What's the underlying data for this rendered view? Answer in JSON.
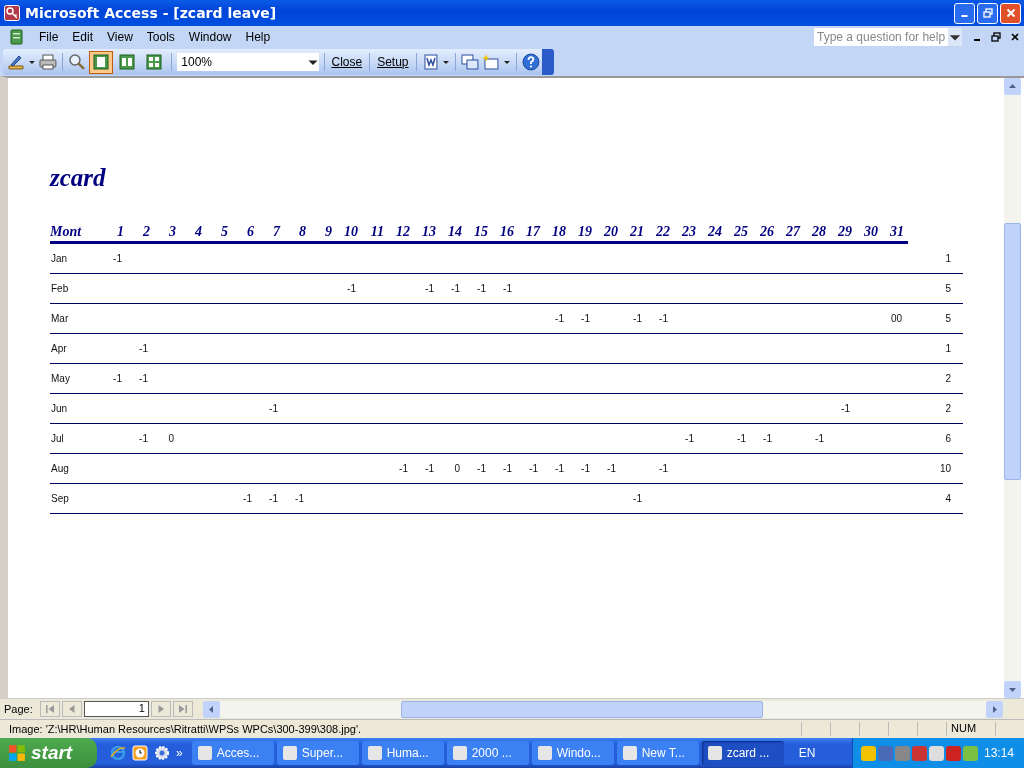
{
  "window": {
    "title": "Microsoft Access - [zcard leave]"
  },
  "menu": {
    "items": [
      "File",
      "Edit",
      "View",
      "Tools",
      "Window",
      "Help"
    ],
    "help_box": {
      "placeholder": "Type a question for help"
    }
  },
  "toolbar": {
    "page_views": [
      {
        "selected": true
      },
      {
        "selected": false
      },
      {
        "selected": false
      }
    ],
    "zoom": "100%",
    "buttons": [
      "Close",
      "Setup"
    ]
  },
  "report": {
    "title": "zcard",
    "columns": [
      "Mont",
      "1",
      "2",
      "3",
      "4",
      "5",
      "6",
      "7",
      "8",
      "9",
      "10",
      "11",
      "12",
      "13",
      "14",
      "15",
      "16",
      "17",
      "18",
      "19",
      "20",
      "21",
      "22",
      "23",
      "24",
      "25",
      "26",
      "27",
      "28",
      "29",
      "30",
      "31"
    ],
    "rows": [
      {
        "month": "Jan",
        "days": [
          {
            "kind": "leave",
            "value": "-1"
          },
          {
            "kind": "blank"
          },
          {
            "kind": "blank"
          },
          {
            "kind": "blank"
          },
          {
            "kind": "blank"
          },
          {
            "kind": "blank"
          },
          {
            "kind": "blank"
          },
          {
            "kind": "blank"
          },
          {
            "kind": "blank"
          },
          {
            "kind": "blank"
          },
          {
            "kind": "blank"
          },
          {
            "kind": "blank"
          },
          {
            "kind": "blank"
          },
          {
            "kind": "blank"
          },
          {
            "kind": "blank"
          },
          {
            "kind": "blank"
          },
          {
            "kind": "blank"
          },
          {
            "kind": "blank"
          },
          {
            "kind": "blank"
          },
          {
            "kind": "blank"
          },
          {
            "kind": "blank"
          },
          {
            "kind": "blank"
          },
          {
            "kind": "blank"
          },
          {
            "kind": "blank"
          },
          {
            "kind": "blank"
          },
          {
            "kind": "blank"
          },
          {
            "kind": "blank"
          },
          {
            "kind": "blank"
          },
          {
            "kind": "blank"
          },
          {
            "kind": "blank"
          },
          {
            "kind": "blank"
          }
        ],
        "total": "1"
      },
      {
        "month": "Feb",
        "days": [
          {
            "kind": "blank"
          },
          {
            "kind": "blank"
          },
          {
            "kind": "blank"
          },
          {
            "kind": "blank"
          },
          {
            "kind": "blank"
          },
          {
            "kind": "blank"
          },
          {
            "kind": "blank"
          },
          {
            "kind": "blank"
          },
          {
            "kind": "blank"
          },
          {
            "kind": "leave",
            "value": "-1"
          },
          {
            "kind": "blank"
          },
          {
            "kind": "blank"
          },
          {
            "kind": "leave",
            "value": "-1"
          },
          {
            "kind": "leave",
            "value": "-1"
          },
          {
            "kind": "leave",
            "value": "-1"
          },
          {
            "kind": "leave",
            "value": "-1"
          },
          {
            "kind": "blank"
          },
          {
            "kind": "blank"
          },
          {
            "kind": "blank"
          },
          {
            "kind": "blank"
          },
          {
            "kind": "blank"
          },
          {
            "kind": "blank"
          },
          {
            "kind": "blank"
          },
          {
            "kind": "blank"
          },
          {
            "kind": "blank"
          },
          {
            "kind": "blank"
          },
          {
            "kind": "blank"
          },
          {
            "kind": "blank"
          },
          {
            "kind": "blank"
          },
          {
            "kind": "blank"
          },
          {
            "kind": "blank"
          }
        ],
        "total": "5"
      },
      {
        "month": "Mar",
        "days": [
          {
            "kind": "blank"
          },
          {
            "kind": "blank"
          },
          {
            "kind": "blank"
          },
          {
            "kind": "blank"
          },
          {
            "kind": "blank"
          },
          {
            "kind": "blank"
          },
          {
            "kind": "blank"
          },
          {
            "kind": "blank"
          },
          {
            "kind": "blank"
          },
          {
            "kind": "blank"
          },
          {
            "kind": "blank"
          },
          {
            "kind": "blank"
          },
          {
            "kind": "blank"
          },
          {
            "kind": "blank"
          },
          {
            "kind": "blank"
          },
          {
            "kind": "blank"
          },
          {
            "kind": "blank"
          },
          {
            "kind": "leave",
            "value": "-1"
          },
          {
            "kind": "leave",
            "value": "-1"
          },
          {
            "kind": "blank"
          },
          {
            "kind": "leave",
            "value": "-1"
          },
          {
            "kind": "leave",
            "value": "-1"
          },
          {
            "kind": "blank"
          },
          {
            "kind": "blank"
          },
          {
            "kind": "blank"
          },
          {
            "kind": "blank"
          },
          {
            "kind": "blank"
          },
          {
            "kind": "blank"
          },
          {
            "kind": "blank"
          },
          {
            "kind": "blank"
          },
          {
            "kind": "leave",
            "value": "00"
          }
        ],
        "total": "5"
      },
      {
        "month": "Apr",
        "days": [
          {
            "kind": "blank"
          },
          {
            "kind": "leave",
            "value": "-1"
          },
          {
            "kind": "blank"
          },
          {
            "kind": "blank"
          },
          {
            "kind": "blank"
          },
          {
            "kind": "blank"
          },
          {
            "kind": "blank"
          },
          {
            "kind": "blank"
          },
          {
            "kind": "blank"
          },
          {
            "kind": "blank"
          },
          {
            "kind": "blank"
          },
          {
            "kind": "blank"
          },
          {
            "kind": "blank"
          },
          {
            "kind": "blank"
          },
          {
            "kind": "blank"
          },
          {
            "kind": "blank"
          },
          {
            "kind": "blank"
          },
          {
            "kind": "blank"
          },
          {
            "kind": "blank"
          },
          {
            "kind": "blank"
          },
          {
            "kind": "blank"
          },
          {
            "kind": "blank"
          },
          {
            "kind": "blank"
          },
          {
            "kind": "blank"
          },
          {
            "kind": "blank"
          },
          {
            "kind": "blank"
          },
          {
            "kind": "blank"
          },
          {
            "kind": "blank"
          },
          {
            "kind": "blank"
          },
          {
            "kind": "blank"
          },
          {
            "kind": "blank"
          }
        ],
        "total": "1"
      },
      {
        "month": "May",
        "days": [
          {
            "kind": "leave",
            "value": "-1"
          },
          {
            "kind": "leave",
            "value": "-1"
          },
          {
            "kind": "blank"
          },
          {
            "kind": "blank"
          },
          {
            "kind": "blank"
          },
          {
            "kind": "blank"
          },
          {
            "kind": "blank"
          },
          {
            "kind": "blank"
          },
          {
            "kind": "blank"
          },
          {
            "kind": "blank"
          },
          {
            "kind": "blank"
          },
          {
            "kind": "blank"
          },
          {
            "kind": "blank"
          },
          {
            "kind": "blank"
          },
          {
            "kind": "blank"
          },
          {
            "kind": "blank"
          },
          {
            "kind": "blank"
          },
          {
            "kind": "blank"
          },
          {
            "kind": "blank"
          },
          {
            "kind": "blank"
          },
          {
            "kind": "blank"
          },
          {
            "kind": "blank"
          },
          {
            "kind": "blank"
          },
          {
            "kind": "blank"
          },
          {
            "kind": "blank"
          },
          {
            "kind": "blank"
          },
          {
            "kind": "blank"
          },
          {
            "kind": "blank"
          },
          {
            "kind": "blank"
          },
          {
            "kind": "blank"
          },
          {
            "kind": "blank"
          }
        ],
        "total": "2"
      },
      {
        "month": "Jun",
        "days": [
          {
            "kind": "blank"
          },
          {
            "kind": "blank"
          },
          {
            "kind": "blank"
          },
          {
            "kind": "blank"
          },
          {
            "kind": "blank"
          },
          {
            "kind": "blank"
          },
          {
            "kind": "leave",
            "value": "-1"
          },
          {
            "kind": "blank"
          },
          {
            "kind": "blank"
          },
          {
            "kind": "blank"
          },
          {
            "kind": "blank"
          },
          {
            "kind": "blank"
          },
          {
            "kind": "blank"
          },
          {
            "kind": "blank"
          },
          {
            "kind": "blank"
          },
          {
            "kind": "blank"
          },
          {
            "kind": "blank"
          },
          {
            "kind": "blank"
          },
          {
            "kind": "blank"
          },
          {
            "kind": "blank"
          },
          {
            "kind": "blank"
          },
          {
            "kind": "blank"
          },
          {
            "kind": "blank"
          },
          {
            "kind": "blank"
          },
          {
            "kind": "blank"
          },
          {
            "kind": "blank"
          },
          {
            "kind": "blank"
          },
          {
            "kind": "blank"
          },
          {
            "kind": "leave",
            "value": "-1"
          },
          {
            "kind": "blank"
          },
          {
            "kind": "blank"
          }
        ],
        "total": "2"
      },
      {
        "month": "Jul",
        "days": [
          {
            "kind": "blank"
          },
          {
            "kind": "leave",
            "value": "-1"
          },
          {
            "kind": "leave",
            "value": "0"
          },
          {
            "kind": "blank"
          },
          {
            "kind": "blank"
          },
          {
            "kind": "blank"
          },
          {
            "kind": "blank"
          },
          {
            "kind": "blank"
          },
          {
            "kind": "blank"
          },
          {
            "kind": "blank"
          },
          {
            "kind": "blank"
          },
          {
            "kind": "blank"
          },
          {
            "kind": "blank"
          },
          {
            "kind": "blank"
          },
          {
            "kind": "blank"
          },
          {
            "kind": "blank"
          },
          {
            "kind": "blank"
          },
          {
            "kind": "blank"
          },
          {
            "kind": "blank"
          },
          {
            "kind": "blank"
          },
          {
            "kind": "blank"
          },
          {
            "kind": "blank"
          },
          {
            "kind": "leave",
            "value": "-1"
          },
          {
            "kind": "blank"
          },
          {
            "kind": "leave",
            "value": "-1"
          },
          {
            "kind": "leave",
            "value": "-1"
          },
          {
            "kind": "blank"
          },
          {
            "kind": "leave",
            "value": "-1"
          },
          {
            "kind": "blank"
          },
          {
            "kind": "blank"
          },
          {
            "kind": "blank"
          }
        ],
        "total": "6"
      },
      {
        "month": "Aug",
        "days": [
          {
            "kind": "blank"
          },
          {
            "kind": "blank"
          },
          {
            "kind": "blank"
          },
          {
            "kind": "blank"
          },
          {
            "kind": "blank"
          },
          {
            "kind": "blank"
          },
          {
            "kind": "blank"
          },
          {
            "kind": "blank"
          },
          {
            "kind": "blank"
          },
          {
            "kind": "blank"
          },
          {
            "kind": "blank"
          },
          {
            "kind": "leave",
            "value": "-1"
          },
          {
            "kind": "leave",
            "value": "-1"
          },
          {
            "kind": "leave",
            "value": "0"
          },
          {
            "kind": "leave",
            "value": "-1"
          },
          {
            "kind": "leave",
            "value": "-1"
          },
          {
            "kind": "leave",
            "value": "-1"
          },
          {
            "kind": "leave",
            "value": "-1"
          },
          {
            "kind": "leave",
            "value": "-1"
          },
          {
            "kind": "leave",
            "value": "-1"
          },
          {
            "kind": "blank"
          },
          {
            "kind": "leave",
            "value": "-1"
          },
          {
            "kind": "blank"
          },
          {
            "kind": "blank"
          },
          {
            "kind": "blank"
          },
          {
            "kind": "blank"
          },
          {
            "kind": "blank"
          },
          {
            "kind": "blank"
          },
          {
            "kind": "blank"
          },
          {
            "kind": "blank"
          },
          {
            "kind": "blank"
          }
        ],
        "total": "10"
      },
      {
        "month": "Sep",
        "days": [
          {
            "kind": "blank"
          },
          {
            "kind": "blank"
          },
          {
            "kind": "blank"
          },
          {
            "kind": "blank"
          },
          {
            "kind": "blank"
          },
          {
            "kind": "leave",
            "value": "-1"
          },
          {
            "kind": "leave",
            "value": "-1"
          },
          {
            "kind": "leave",
            "value": "-1"
          },
          {
            "kind": "blank"
          },
          {
            "kind": "blank"
          },
          {
            "kind": "blank"
          },
          {
            "kind": "blank"
          },
          {
            "kind": "blank"
          },
          {
            "kind": "blank"
          },
          {
            "kind": "blank"
          },
          {
            "kind": "blank"
          },
          {
            "kind": "blank"
          },
          {
            "kind": "blank"
          },
          {
            "kind": "blank"
          },
          {
            "kind": "blank"
          },
          {
            "kind": "leave",
            "value": "-1"
          },
          {
            "kind": "blank"
          },
          {
            "kind": "blank"
          },
          {
            "kind": "blank"
          },
          {
            "kind": "blank"
          },
          {
            "kind": "blank"
          },
          {
            "kind": "blank"
          },
          {
            "kind": "blank"
          },
          {
            "kind": "blank"
          },
          {
            "kind": "blank"
          },
          {
            "kind": "blank"
          }
        ],
        "total": "4"
      }
    ]
  },
  "page_nav": {
    "label": "Page:",
    "value": "1"
  },
  "status_bar": {
    "text": "Image: 'Z:\\HR\\Human Resources\\Ritratti\\WPSs WPCs\\300-399\\308.jpg'.",
    "num": "NUM"
  },
  "taskbar": {
    "start": "start",
    "more": "»",
    "tasks": [
      {
        "label": "Acces...",
        "selected": false
      },
      {
        "label": "Super...",
        "selected": false
      },
      {
        "label": "Huma...",
        "selected": false
      },
      {
        "label": "2000 ...",
        "selected": false
      },
      {
        "label": "Windo...",
        "selected": false
      },
      {
        "label": "New T...",
        "selected": false
      },
      {
        "label": "zcard ...",
        "selected": true
      }
    ],
    "language": "EN",
    "clock": "13:14"
  }
}
